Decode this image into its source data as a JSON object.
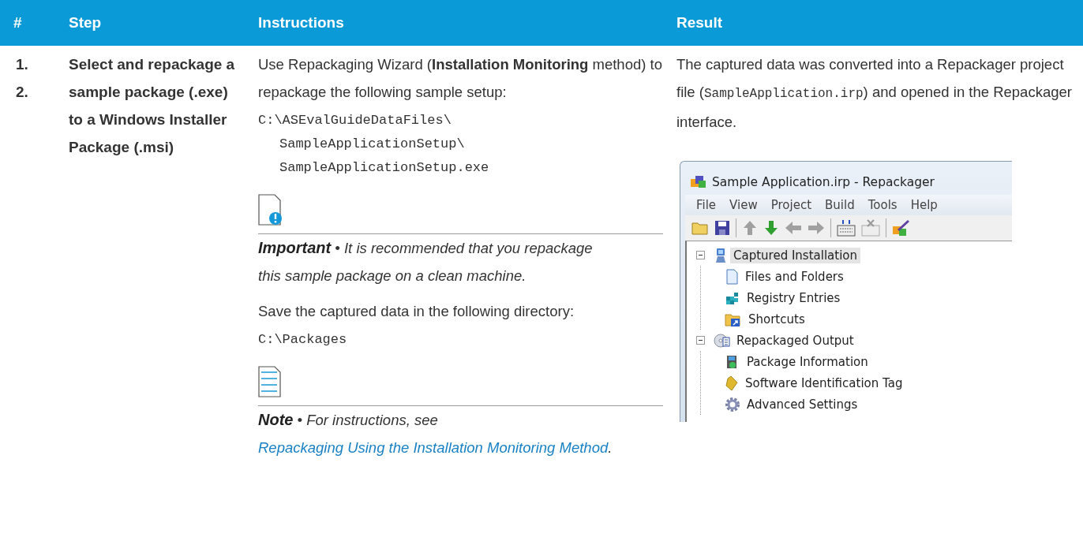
{
  "table": {
    "columns": [
      "#",
      "Step",
      "Instructions",
      "Result"
    ],
    "rows": [
      {
        "numbers": [
          "1.",
          "2."
        ],
        "step": "Select and repackage a sample package (.exe) to a Windows Installer Package (.msi)",
        "instructions": [
          {
            "kind": "paragraph",
            "text": "Use Repackaging Wizard (**Installation Monitoring** method) to repackage the following sample setup:"
          },
          {
            "kind": "code",
            "lines": [
              "C:\\ASEvalGuideDataFiles\\",
              "SampleApplicationSetup\\",
              "SampleApplicationSetup.exe"
            ]
          },
          {
            "kind": "important",
            "label": "Important",
            "separator": "•",
            "text": "It is recommended that you repackage this sample package on a clean machine."
          },
          {
            "kind": "paragraph",
            "text": "Save the captured data in the following directory:"
          },
          {
            "kind": "code",
            "lines": [
              "C:\\Packages"
            ]
          },
          {
            "kind": "note",
            "label": "Note",
            "separator": "•",
            "text": "For instructions, see",
            "link": "Repackaging Using the Installation Monitoring Method",
            "after": "."
          }
        ],
        "result": {
          "paragraph": [
            {
              "kind": "text",
              "text": "The captured data was converted into a Repackager project file ("
            },
            {
              "kind": "code",
              "text": "SampleApplication.irp"
            },
            {
              "kind": "text",
              "text": ") and opened in the Repackager interface."
            }
          ],
          "screenshot": {
            "title": "Sample Application.irp - Repackager",
            "menu": [
              "File",
              "View",
              "Project",
              "Build",
              "Tools",
              "Help"
            ],
            "tree": [
              {
                "label": "Captured Installation",
                "selected": true,
                "expanded": true,
                "children": [
                  {
                    "label": "Files and Folders",
                    "selected": false
                  },
                  {
                    "label": "Registry Entries",
                    "selected": false
                  },
                  {
                    "label": "Shortcuts",
                    "selected": false
                  }
                ]
              },
              {
                "label": "Repackaged Output",
                "selected": false,
                "expanded": true,
                "children": [
                  {
                    "label": "Package Information",
                    "selected": false
                  },
                  {
                    "label": "Software Identification Tag",
                    "selected": false
                  },
                  {
                    "label": "Advanced Settings",
                    "selected": false
                  }
                ]
              }
            ]
          }
        }
      }
    ]
  }
}
